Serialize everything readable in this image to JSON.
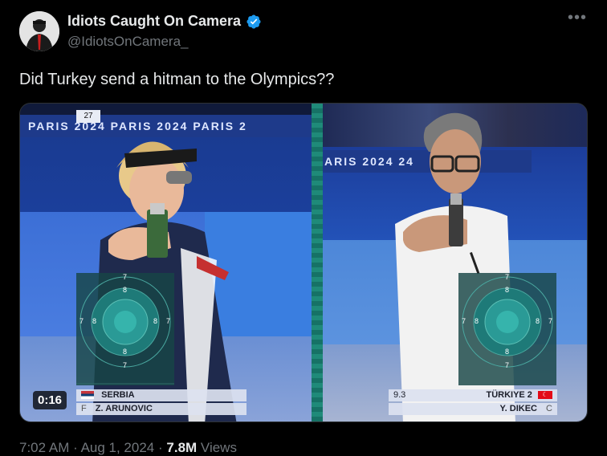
{
  "author": {
    "display_name": "Idiots Caught On Camera",
    "handle": "@IdiotsOnCamera_",
    "verified": true
  },
  "tweet": {
    "text": "Did Turkey send a hitman to the Olympics??"
  },
  "media": {
    "left_panel": {
      "banner_text": "PARIS 2024  PARIS 2024  PARIS 2",
      "lane_number": "27",
      "country": "SERBIA",
      "athlete_prefix": "F",
      "athlete": "Z. ARUNOVIC",
      "target_rings": [
        "7",
        "8",
        "7",
        "8",
        "8",
        "7",
        "8",
        "7"
      ]
    },
    "right_panel": {
      "banner_text": "ARIS 2024           24",
      "score": "9.3",
      "country": "TÜRKIYE 2",
      "athlete": "Y. DIKEC",
      "athlete_suffix": "C",
      "target_rings": [
        "7",
        "8",
        "7",
        "8",
        "8",
        "7",
        "8",
        "7"
      ]
    },
    "duration": "0:16"
  },
  "footer": {
    "time": "7:02 AM",
    "date": "Aug 1, 2024",
    "views_count": "7.8M",
    "views_label": "Views"
  },
  "colors": {
    "verified": "#1d9bf0",
    "muted_text": "#71767b",
    "primary_text": "#e7e9ea"
  }
}
